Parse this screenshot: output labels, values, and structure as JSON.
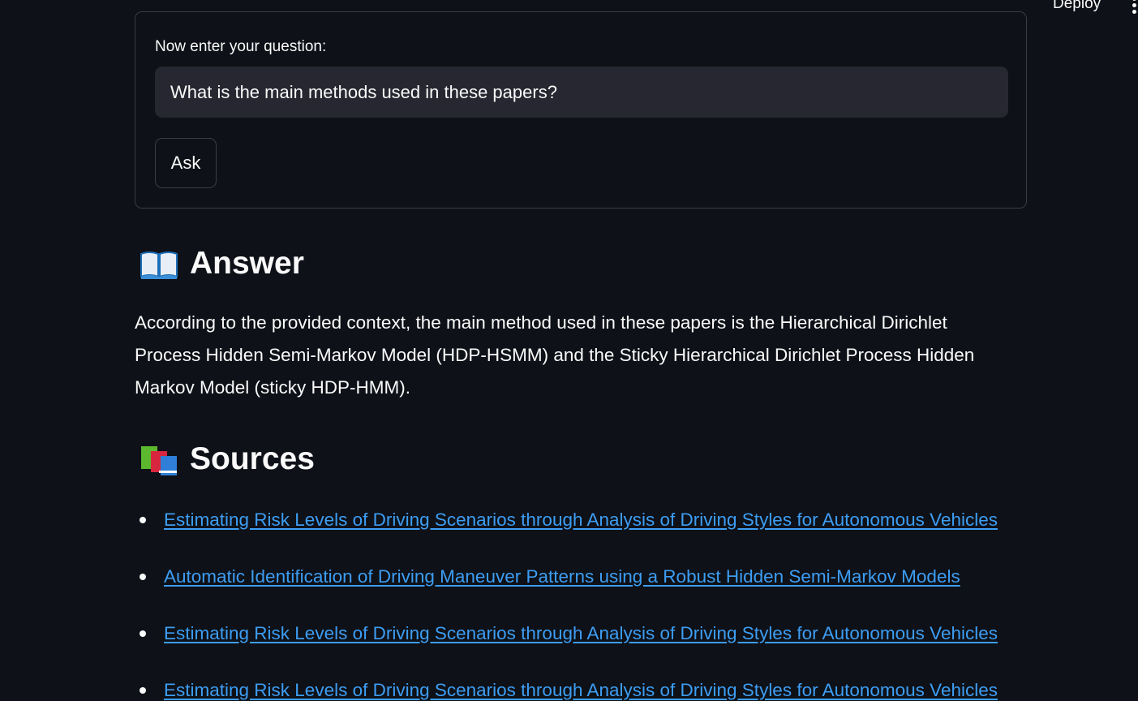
{
  "topbar": {
    "deploy_label": "Deploy",
    "menu_icon": "vertical-ellipsis-icon"
  },
  "form": {
    "label": "Now enter your question:",
    "input_value": "What is the main methods used in these papers?",
    "ask_label": "Ask"
  },
  "answer": {
    "emoji_icon": "open-book-icon",
    "heading": "Answer",
    "text": "According to the provided context, the main method used in these papers is the Hierarchical Dirichlet Process Hidden Semi-Markov Model (HDP-HSMM) and the Sticky Hierarchical Dirichlet Process Hidden Markov Model (sticky HDP-HMM)."
  },
  "sources": {
    "emoji_icon": "books-icon",
    "heading": "Sources",
    "items": [
      "Estimating Risk Levels of Driving Scenarios through Analysis of Driving Styles for Autonomous Vehicles",
      "Automatic Identification of Driving Maneuver Patterns using a Robust Hidden Semi-Markov Models",
      "Estimating Risk Levels of Driving Scenarios through Analysis of Driving Styles for Autonomous Vehicles",
      "Estimating Risk Levels of Driving Scenarios through Analysis of Driving Styles for Autonomous Vehicles"
    ]
  },
  "colors": {
    "background": "#0e1117",
    "input_background": "#262730",
    "link": "#3d9df3",
    "border": "#3b3d45"
  }
}
